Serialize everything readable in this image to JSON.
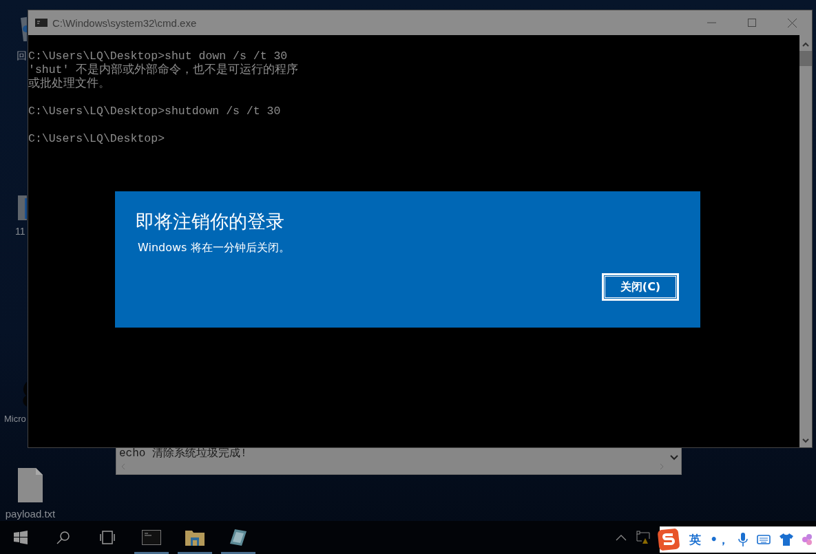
{
  "desktop_icons": [
    {
      "kind": "recycle",
      "label": "回"
    },
    {
      "kind": "window",
      "label": "11"
    },
    {
      "kind": "dragon",
      "label": "Micro"
    },
    {
      "kind": "file",
      "label": "payload.txt"
    }
  ],
  "console": {
    "title": "C:\\Windows\\system32\\cmd.exe",
    "blocks": [
      [
        "C:\\Users\\LQ\\Desktop>shut down /s /t 30",
        "'shut' 不是内部或外部命令，也不是可运行的程序",
        "或批处理文件。"
      ],
      [
        "C:\\Users\\LQ\\Desktop>shutdown /s /t 30"
      ],
      [
        "C:\\Users\\LQ\\Desktop>"
      ]
    ]
  },
  "editor": {
    "line": "echo 清除系统垃圾完成!"
  },
  "dialog": {
    "title": "即将注销你的登录",
    "message": "Windows 将在一分钟后关闭。",
    "button": "关闭(C)"
  },
  "taskbar": {
    "apps": [
      {
        "kind": "console",
        "running": true
      },
      {
        "kind": "folder",
        "running": true
      },
      {
        "kind": "notepad",
        "running": true
      }
    ]
  },
  "ime": {
    "mode": "英",
    "punctuation": "•，"
  }
}
